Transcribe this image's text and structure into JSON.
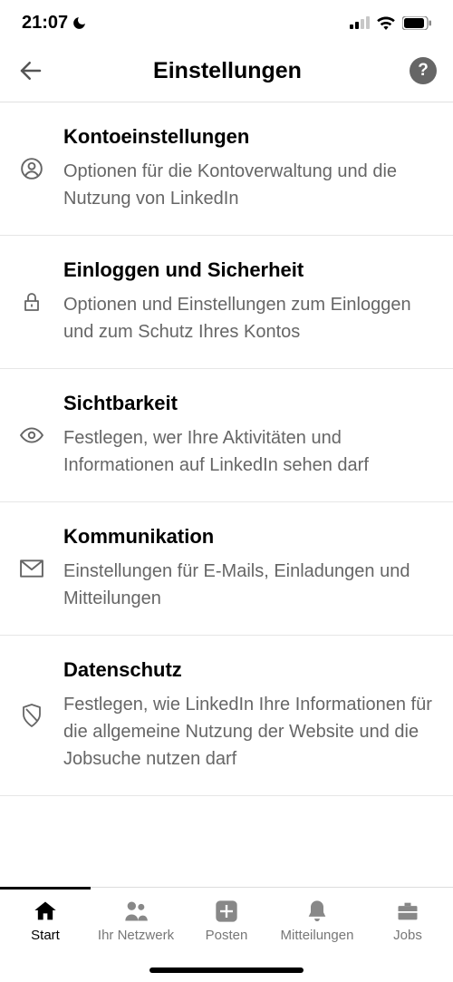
{
  "status": {
    "time": "21:07"
  },
  "header": {
    "title": "Einstellungen"
  },
  "settings": {
    "items": [
      {
        "title": "Kontoeinstellungen",
        "desc": "Optionen für die Kontoverwaltung und die Nutzung von LinkedIn",
        "icon": "person"
      },
      {
        "title": "Einloggen und Sicherheit",
        "desc": "Optionen und Einstellungen zum Einloggen und zum Schutz Ihres Kontos",
        "icon": "lock"
      },
      {
        "title": "Sichtbarkeit",
        "desc": "Festlegen, wer Ihre Aktivitäten und Informationen auf LinkedIn sehen darf",
        "icon": "eye"
      },
      {
        "title": "Kommunikation",
        "desc": "Einstellungen für E-Mails, Einladungen und Mitteilungen",
        "icon": "mail"
      },
      {
        "title": "Datenschutz",
        "desc": "Festlegen, wie LinkedIn Ihre Informationen für die allgemeine Nutzung der Website und die Jobsuche nutzen darf",
        "icon": "shield"
      }
    ]
  },
  "nav": {
    "items": [
      {
        "label": "Start",
        "icon": "home",
        "active": true
      },
      {
        "label": "Ihr Netzwerk",
        "icon": "people",
        "active": false
      },
      {
        "label": "Posten",
        "icon": "plus",
        "active": false
      },
      {
        "label": "Mitteilungen",
        "icon": "bell",
        "active": false
      },
      {
        "label": "Jobs",
        "icon": "briefcase",
        "active": false
      }
    ]
  }
}
